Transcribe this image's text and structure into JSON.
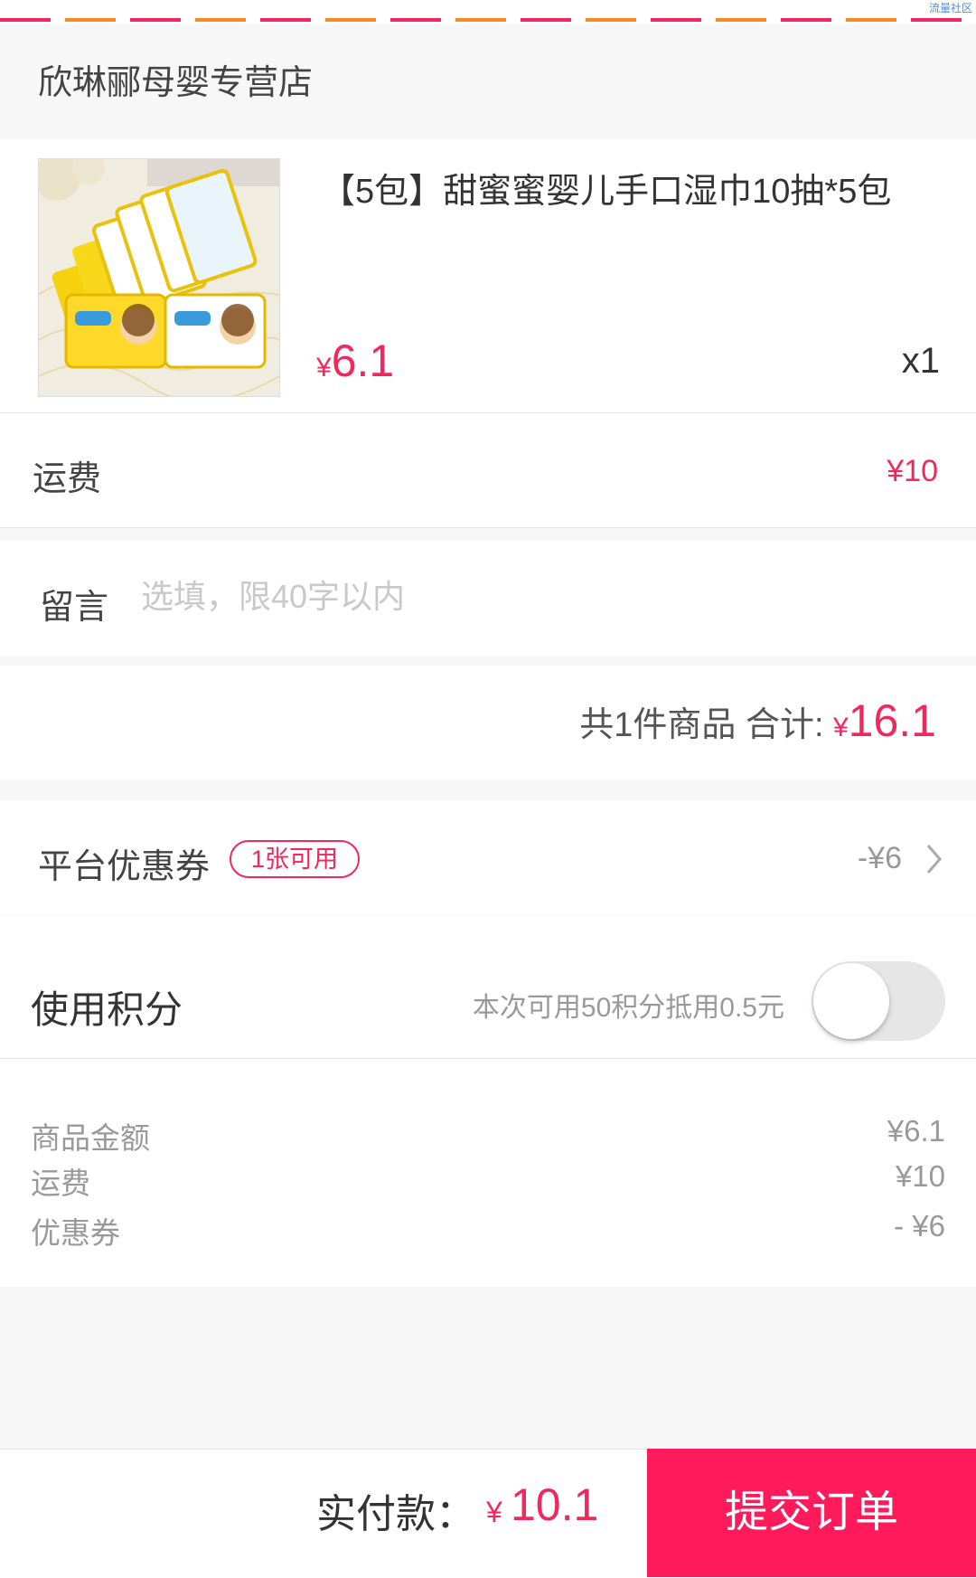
{
  "watermark": "流量社区",
  "shop": {
    "name": "欣琳郦母婴专营店"
  },
  "product": {
    "image_alt": "婴儿手口湿巾包装",
    "title": "【5包】甜蜜蜜婴儿手口湿巾10抽*5包",
    "currency": "¥",
    "price": "6.1",
    "quantity": "x1"
  },
  "freight": {
    "label": "运费",
    "value": "¥10"
  },
  "message": {
    "label": "留言",
    "placeholder": "选填，限40字以内",
    "value": ""
  },
  "order_total": {
    "count_text": "共1件商品 合计:",
    "currency": "¥",
    "amount": "16.1"
  },
  "coupon": {
    "label": "平台优惠券",
    "badge": "1张可用",
    "value": "-¥6",
    "chevron_icon": "chevron-right-icon"
  },
  "points": {
    "label": "使用积分",
    "hint": "本次可用50积分抵用0.5元",
    "enabled": false
  },
  "summary": {
    "items": [
      {
        "label": "商品金额",
        "value": "¥6.1"
      },
      {
        "label": "运费",
        "value": "¥10"
      },
      {
        "label": "优惠券",
        "value": "- ¥6"
      }
    ]
  },
  "footer": {
    "pay_label": "实付款：",
    "currency": "¥",
    "pay_amount": "10.1",
    "submit_label": "提交订单"
  },
  "colors": {
    "accent": "#f2275e",
    "submit_bg": "#ff1a5c",
    "stripe_pink": "#f2275e",
    "stripe_orange": "#f7891f"
  }
}
